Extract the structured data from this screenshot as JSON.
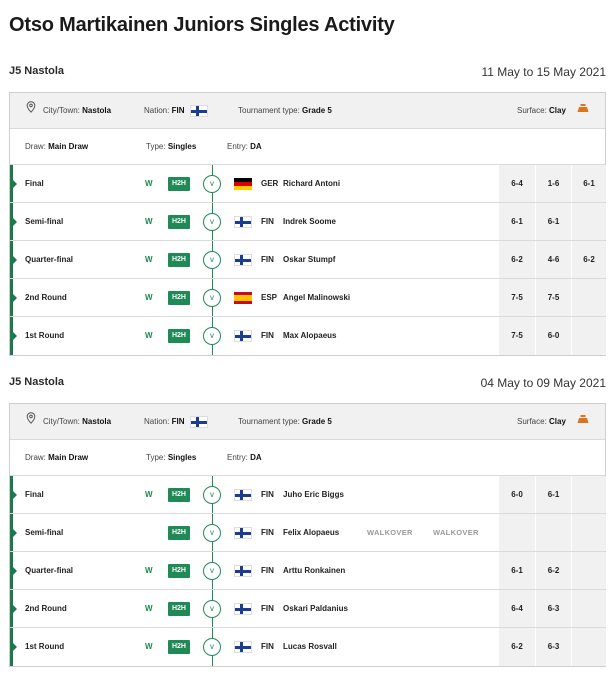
{
  "page_title": "Otso Martikainen Juniors Singles Activity",
  "colors": {
    "accent": "#1a7a4c",
    "h2h_bg": "#1f8a55",
    "win": "#1a8a4c",
    "clay": "#d9751e"
  },
  "tournaments": [
    {
      "name": "J5 Nastola",
      "dates": "11 May to 15 May 2021",
      "info": {
        "city_label": "City/Town:",
        "city": "Nastola",
        "nation_label": "Nation:",
        "nation": "FIN",
        "type_label": "Tournament type:",
        "type": "Grade 5",
        "surface_label": "Surface:",
        "surface": "Clay",
        "draw_label": "Draw:",
        "draw": "Main Draw",
        "stype_label": "Type:",
        "stype": "Singles",
        "entry_label": "Entry:",
        "entry": "DA"
      },
      "matches": [
        {
          "round": "Final",
          "result": "W",
          "h2h": "H2H",
          "vs": "v",
          "flag": "ger",
          "nation": "GER",
          "opponent": "Richard Antoni",
          "sets": [
            "6-4",
            "1-6",
            "6-1"
          ]
        },
        {
          "round": "Semi-final",
          "result": "W",
          "h2h": "H2H",
          "vs": "v",
          "flag": "fin",
          "nation": "FIN",
          "opponent": "Indrek Soome",
          "sets": [
            "6-1",
            "6-1",
            ""
          ]
        },
        {
          "round": "Quarter-final",
          "result": "W",
          "h2h": "H2H",
          "vs": "v",
          "flag": "fin",
          "nation": "FIN",
          "opponent": "Oskar Stumpf",
          "sets": [
            "6-2",
            "4-6",
            "6-2"
          ]
        },
        {
          "round": "2nd Round",
          "result": "W",
          "h2h": "H2H",
          "vs": "v",
          "flag": "esp",
          "nation": "ESP",
          "opponent": "Angel Malinowski",
          "sets": [
            "7-5",
            "7-5",
            ""
          ]
        },
        {
          "round": "1st Round",
          "result": "W",
          "h2h": "H2H",
          "vs": "v",
          "flag": "fin",
          "nation": "FIN",
          "opponent": "Max Alopaeus",
          "sets": [
            "7-5",
            "6-0",
            ""
          ]
        }
      ]
    },
    {
      "name": "J5 Nastola",
      "dates": "04 May to 09 May 2021",
      "info": {
        "city_label": "City/Town:",
        "city": "Nastola",
        "nation_label": "Nation:",
        "nation": "FIN",
        "type_label": "Tournament type:",
        "type": "Grade 5",
        "surface_label": "Surface:",
        "surface": "Clay",
        "draw_label": "Draw:",
        "draw": "Main Draw",
        "stype_label": "Type:",
        "stype": "Singles",
        "entry_label": "Entry:",
        "entry": "DA"
      },
      "matches": [
        {
          "round": "Final",
          "result": "W",
          "h2h": "H2H",
          "vs": "v",
          "flag": "fin",
          "nation": "FIN",
          "opponent": "Juho Eric Biggs",
          "sets": [
            "6-0",
            "6-1",
            ""
          ]
        },
        {
          "round": "Semi-final",
          "result": "",
          "h2h": "H2H",
          "vs": "v",
          "flag": "fin",
          "nation": "FIN",
          "opponent": "Felix Alopaeus",
          "walkover": [
            "WALKOVER",
            "WALKOVER"
          ],
          "sets": [
            "",
            "",
            ""
          ]
        },
        {
          "round": "Quarter-final",
          "result": "W",
          "h2h": "H2H",
          "vs": "v",
          "flag": "fin",
          "nation": "FIN",
          "opponent": "Arttu Ronkainen",
          "sets": [
            "6-1",
            "6-2",
            ""
          ]
        },
        {
          "round": "2nd Round",
          "result": "W",
          "h2h": "H2H",
          "vs": "v",
          "flag": "fin",
          "nation": "FIN",
          "opponent": "Oskari Paldanius",
          "sets": [
            "6-4",
            "6-3",
            ""
          ]
        },
        {
          "round": "1st Round",
          "result": "W",
          "h2h": "H2H",
          "vs": "v",
          "flag": "fin",
          "nation": "FIN",
          "opponent": "Lucas Rosvall",
          "sets": [
            "6-2",
            "6-3",
            ""
          ]
        }
      ]
    }
  ]
}
